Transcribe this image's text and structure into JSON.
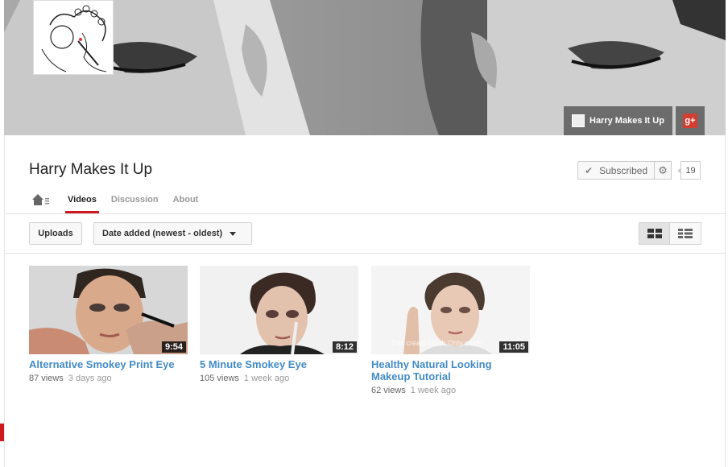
{
  "channel": {
    "name": "Harry Makes It Up",
    "banner_link_label": "Harry Makes It Up",
    "gplus_label": "g+"
  },
  "subscribe": {
    "label": "Subscribed",
    "count": "19"
  },
  "tabs": [
    {
      "label": "Videos",
      "active": true
    },
    {
      "label": "Discussion",
      "active": false
    },
    {
      "label": "About",
      "active": false
    }
  ],
  "toolbar": {
    "uploads_label": "Uploads",
    "sort_label": "Date added (newest - oldest)"
  },
  "videos": [
    {
      "title": "Alternative Smokey Print Eye",
      "duration": "9:54",
      "views": "87 views",
      "age": "3 days ago"
    },
    {
      "title": "5 Minute Smokey Eye",
      "duration": "8:12",
      "views": "105 views",
      "age": "1 week ago"
    },
    {
      "title": "Healthy Natural Looking Makeup Tutorial",
      "duration": "11:05",
      "views": "62 views",
      "age": "1 week ago",
      "caption_overlay": "This cream blush Only costs"
    }
  ],
  "colors": {
    "accent_red": "#cc181e",
    "link_blue": "#438bc5"
  }
}
